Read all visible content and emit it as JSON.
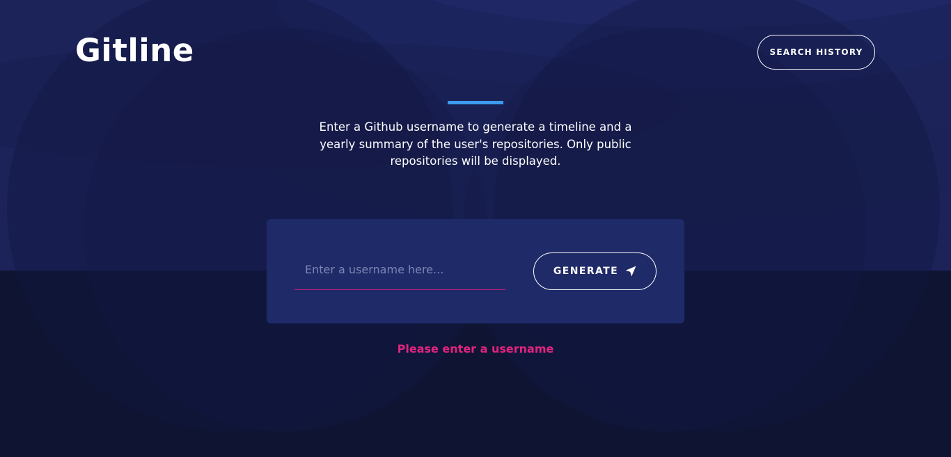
{
  "header": {
    "logo_text": "Gitline",
    "search_history_label": "SEARCH HISTORY"
  },
  "intro": {
    "description": "Enter a Github username to generate a timeline and a yearly summary of the user's repositories. Only public repositories will be displayed."
  },
  "form": {
    "username_placeholder": "Enter a username here...",
    "username_value": "",
    "generate_label": "GENERATE",
    "generate_icon": "paper-plane-icon",
    "error_message": "Please enter a username"
  },
  "colors": {
    "background_top": "#1b2358",
    "background_bottom": "#0f1433",
    "card": "#1f2a68",
    "accent_line": "#3d9bef",
    "error": "#e0247f",
    "input_underline": "#c8247a",
    "text": "#ffffff"
  }
}
